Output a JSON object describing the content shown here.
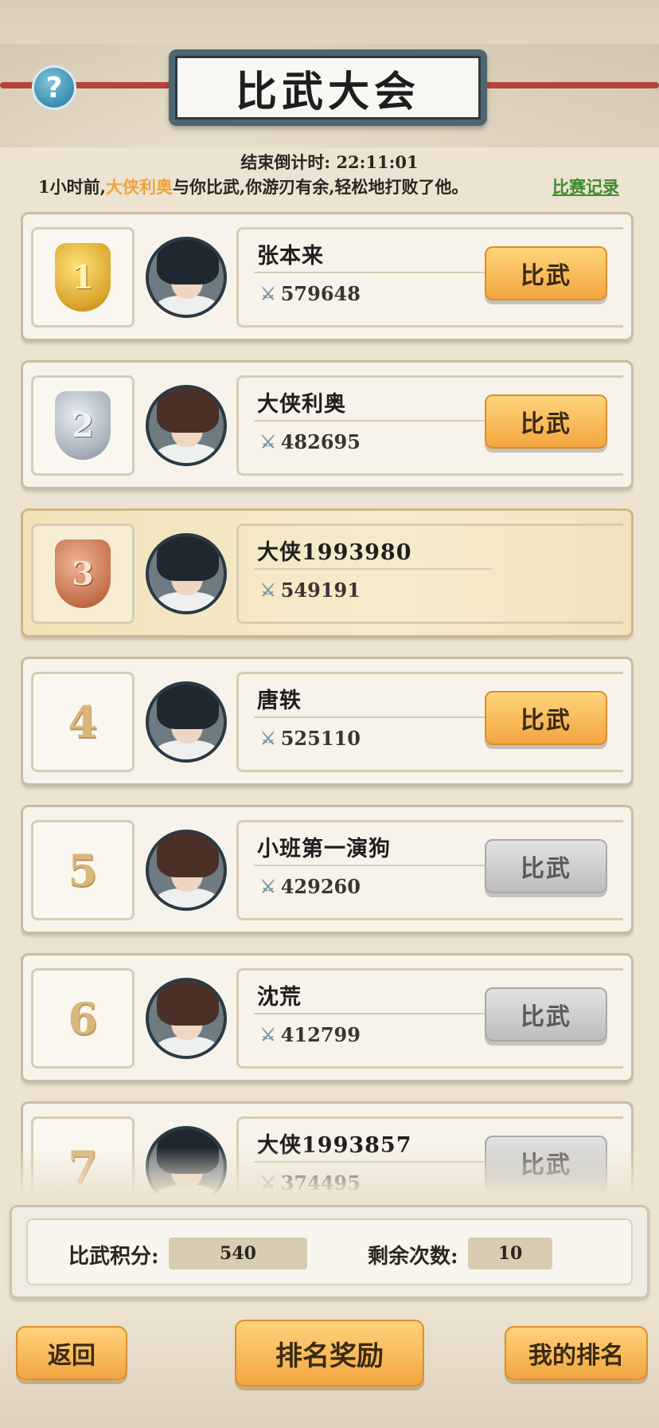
{
  "header": {
    "title": "比武大会",
    "help_icon": "?",
    "countdown_label": "结束倒计时:",
    "countdown_value": "22:11:01"
  },
  "battle_message": {
    "prefix": "1小时前,",
    "opponent": "大侠利奥",
    "suffix": "与你比武,你游刃有余,轻松地打败了他。",
    "record_link": "比赛记录"
  },
  "players": [
    {
      "rank": "1",
      "medal": "gold",
      "name": "张本来",
      "power": "579648",
      "button": "比武",
      "button_enabled": true
    },
    {
      "rank": "2",
      "medal": "silver",
      "name": "大侠利奥",
      "power": "482695",
      "button": "比武",
      "button_enabled": true
    },
    {
      "rank": "3",
      "medal": "bronze",
      "name": "大侠1993980",
      "power": "549191",
      "button": "",
      "button_enabled": false,
      "is_self": true
    },
    {
      "rank": "4",
      "name": "唐轶",
      "power": "525110",
      "button": "比武",
      "button_enabled": true
    },
    {
      "rank": "5",
      "name": "小班第一演狗",
      "power": "429260",
      "button": "比武",
      "button_enabled": false
    },
    {
      "rank": "6",
      "name": "沈荒",
      "power": "412799",
      "button": "比武",
      "button_enabled": false
    },
    {
      "rank": "7",
      "name": "大侠1993857",
      "power": "374495",
      "button": "比武",
      "button_enabled": false
    }
  ],
  "stats": {
    "score_label": "比武积分:",
    "score_value": "540",
    "remaining_label": "剩余次数:",
    "remaining_value": "10"
  },
  "footer": {
    "back_label": "返回",
    "rewards_label": "排名奖励",
    "my_rank_label": "我的排名"
  },
  "icons": {
    "power": "sword-icon",
    "help": "question-icon"
  },
  "colors": {
    "highlight_name": "#f0a535",
    "record_link": "#3f8c2c",
    "button_active": "#f2a640",
    "button_disabled": "#bdbdbd"
  }
}
